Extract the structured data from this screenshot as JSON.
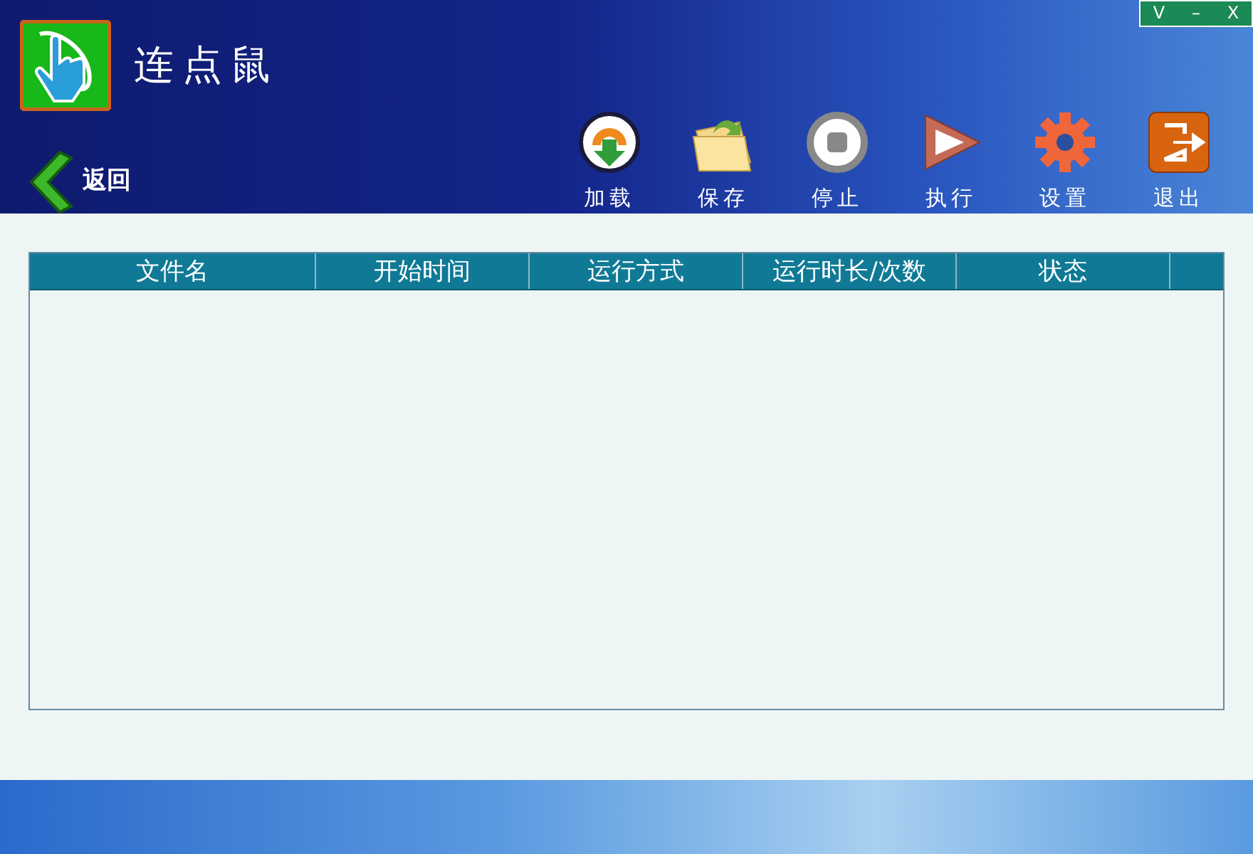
{
  "window_controls": [
    "V",
    "–",
    "X"
  ],
  "app": {
    "title": "连点鼠"
  },
  "back": {
    "label": "返回"
  },
  "toolbar": [
    {
      "kind": "load",
      "label": "加载"
    },
    {
      "kind": "save",
      "label": "保存"
    },
    {
      "kind": "stop",
      "label": "停止"
    },
    {
      "kind": "run",
      "label": "执行"
    },
    {
      "kind": "settings",
      "label": "设置"
    },
    {
      "kind": "exit",
      "label": "退出"
    }
  ],
  "table": {
    "columns": [
      "文件名",
      "开始时间",
      "运行方式",
      "运行时长/次数",
      "状态"
    ]
  }
}
